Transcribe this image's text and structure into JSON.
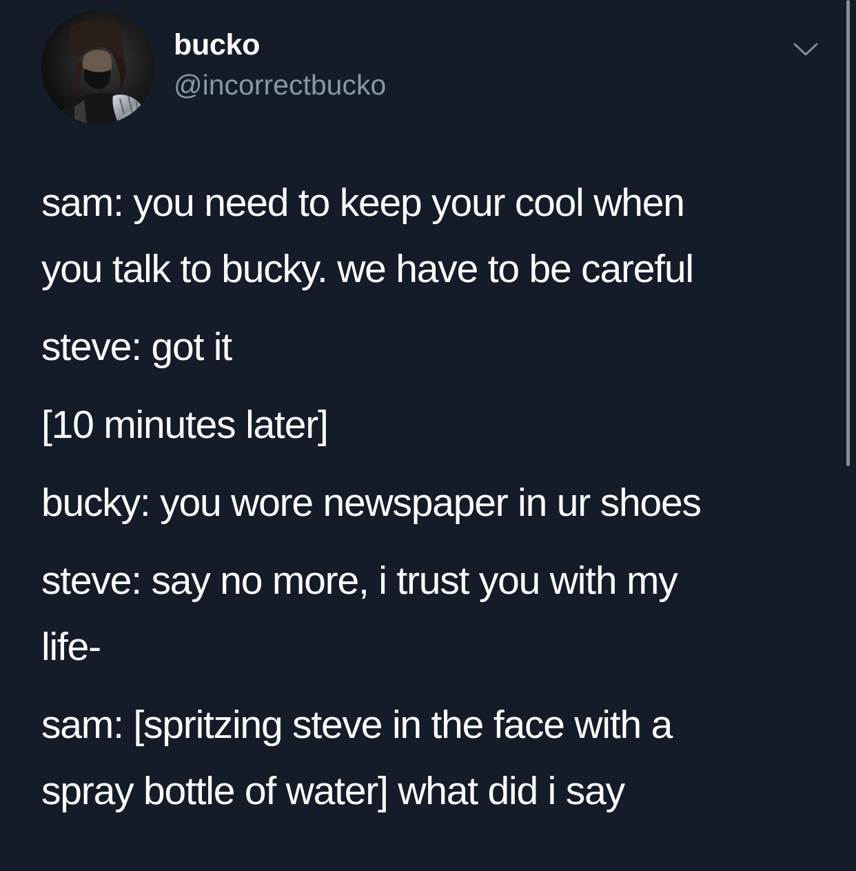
{
  "tweet": {
    "author": {
      "display_name": "bucko",
      "handle": "@incorrectbucko"
    },
    "icons": {
      "avatar": "profile-photo",
      "menu": "chevron-down-icon"
    },
    "colors": {
      "background": "#151c29",
      "text": "#ffffff",
      "secondary_text": "#8899a6"
    },
    "text": {
      "line_1": "sam: you need to keep your cool when",
      "line_2": "you talk to bucky. we have to be careful",
      "line_3": "steve: got it",
      "line_4": "[10 minutes later]",
      "line_5": "bucky: you wore newspaper in ur shoes",
      "line_6": "steve: say no more, i trust you with my",
      "line_7": "life-",
      "line_8": "sam: [spritzing steve in the face with a",
      "line_9": "spray bottle of water] what did i say"
    }
  }
}
